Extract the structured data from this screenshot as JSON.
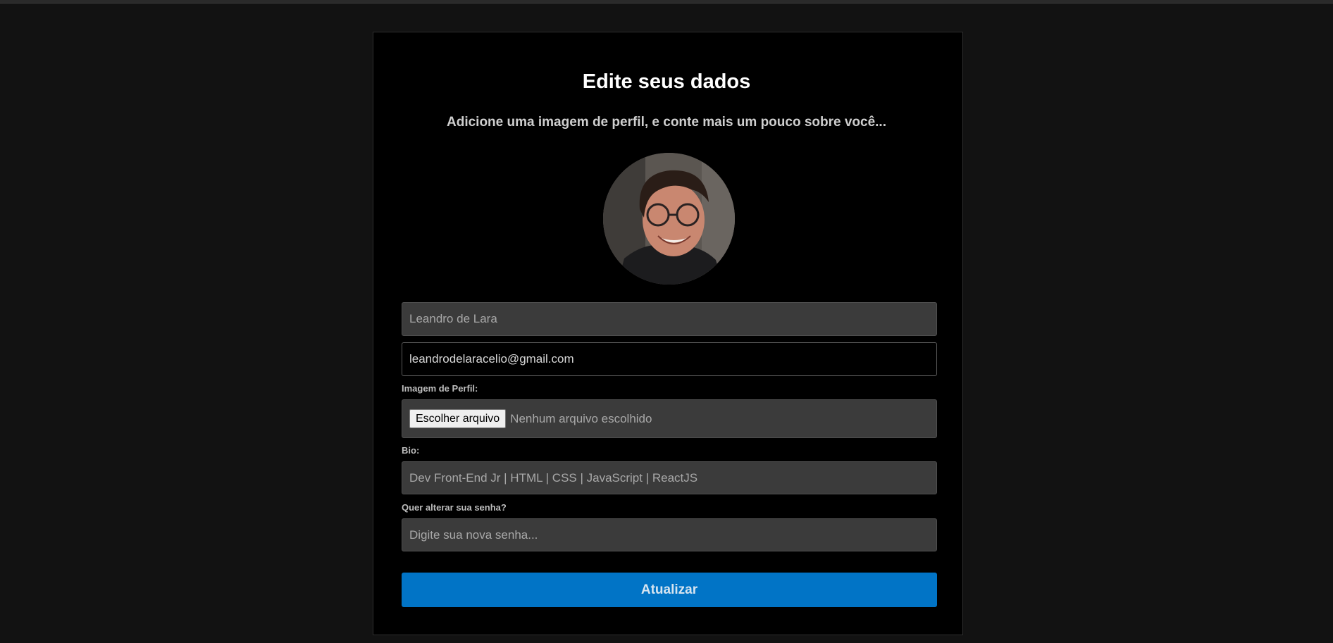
{
  "form": {
    "title": "Edite seus dados",
    "subtitle": "Adicione uma imagem de perfil, e conte mais um pouco sobre você...",
    "avatar_icon": "user-photo-avatar",
    "name_value": "Leandro de Lara",
    "email_value": "leandrodelaracelio@gmail.com",
    "image_label": "Imagem de Perfil:",
    "file_button_label": "Escolher arquivo",
    "file_status": "Nenhum arquivo escolhido",
    "bio_label": "Bio:",
    "bio_value": "Dev Front-End Jr | HTML | CSS | JavaScript | ReactJS",
    "password_label": "Quer alterar sua senha?",
    "password_placeholder": "Digite sua nova senha...",
    "submit_label": "Atualizar"
  },
  "colors": {
    "page_background": "#121212",
    "card_background": "#000000",
    "input_background": "#3b3b3b",
    "button_accent": "#0174c6"
  }
}
